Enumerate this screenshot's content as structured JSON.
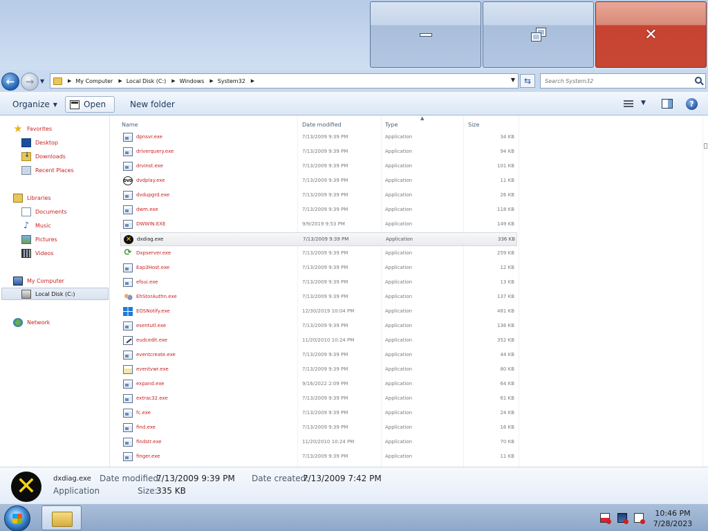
{
  "window": {
    "caption_buttons": [
      "minimize",
      "restore",
      "close"
    ]
  },
  "address": {
    "crumbs": [
      "My Computer",
      "Local Disk (C:)",
      "Windows",
      "System32"
    ],
    "search_placeholder": "Search System32"
  },
  "toolbar": {
    "organize": "Organize",
    "open": "Open",
    "new_folder": "New folder"
  },
  "nav": {
    "favorites": "Favorites",
    "desktop": "Desktop",
    "downloads": "Downloads",
    "recent_places": "Recent Places",
    "libraries": "Libraries",
    "documents": "Documents",
    "music": "Music",
    "pictures": "Pictures",
    "videos": "Videos",
    "my_computer": "My Computer",
    "local_disk": "Local Disk (C:)",
    "network": "Network"
  },
  "columns": {
    "name": "Name",
    "date_modified": "Date modified",
    "type": "Type",
    "size": "Size"
  },
  "files": [
    {
      "name": "dpnsvr.exe",
      "date": "7/13/2009 9:39 PM",
      "type": "Application",
      "size": "34 KB",
      "icon": "app"
    },
    {
      "name": "driverquery.exe",
      "date": "7/13/2009 9:39 PM",
      "type": "Application",
      "size": "94 KB",
      "icon": "app"
    },
    {
      "name": "drvinst.exe",
      "date": "7/13/2009 9:39 PM",
      "type": "Application",
      "size": "101 KB",
      "icon": "app"
    },
    {
      "name": "dvdplay.exe",
      "date": "7/13/2009 9:39 PM",
      "type": "Application",
      "size": "11 KB",
      "icon": "dvd"
    },
    {
      "name": "dvdupgrd.exe",
      "date": "7/13/2009 9:39 PM",
      "type": "Application",
      "size": "26 KB",
      "icon": "app"
    },
    {
      "name": "dwm.exe",
      "date": "7/13/2009 9:39 PM",
      "type": "Application",
      "size": "118 KB",
      "icon": "app"
    },
    {
      "name": "DWWIN.EXE",
      "date": "9/9/2019 9:53 PM",
      "type": "Application",
      "size": "149 KB",
      "icon": "app"
    },
    {
      "name": "dxdiag.exe",
      "date": "7/13/2009 9:39 PM",
      "type": "Application",
      "size": "336 KB",
      "icon": "dx",
      "selected": true
    },
    {
      "name": "Dxpserver.exe",
      "date": "7/13/2009 9:39 PM",
      "type": "Application",
      "size": "259 KB",
      "icon": "sync"
    },
    {
      "name": "Eap3Host.exe",
      "date": "7/13/2009 9:39 PM",
      "type": "Application",
      "size": "12 KB",
      "icon": "app"
    },
    {
      "name": "efsui.exe",
      "date": "7/13/2009 9:39 PM",
      "type": "Application",
      "size": "13 KB",
      "icon": "app"
    },
    {
      "name": "EhStorAuthn.exe",
      "date": "7/13/2009 9:39 PM",
      "type": "Application",
      "size": "137 KB",
      "icon": "users"
    },
    {
      "name": "EOSNotify.exe",
      "date": "12/30/2019 10:04 PM",
      "type": "Application",
      "size": "481 KB",
      "icon": "win"
    },
    {
      "name": "esentutl.exe",
      "date": "7/13/2009 9:39 PM",
      "type": "Application",
      "size": "136 KB",
      "icon": "app"
    },
    {
      "name": "eudcedit.exe",
      "date": "11/20/2010 10:24 PM",
      "type": "Application",
      "size": "352 KB",
      "icon": "edit"
    },
    {
      "name": "eventcreate.exe",
      "date": "7/13/2009 9:39 PM",
      "type": "Application",
      "size": "44 KB",
      "icon": "app"
    },
    {
      "name": "eventvwr.exe",
      "date": "7/13/2009 9:39 PM",
      "type": "Application",
      "size": "80 KB",
      "icon": "evt"
    },
    {
      "name": "expand.exe",
      "date": "9/16/2022 2:09 PM",
      "type": "Application",
      "size": "64 KB",
      "icon": "app"
    },
    {
      "name": "extrac32.exe",
      "date": "7/13/2009 9:39 PM",
      "type": "Application",
      "size": "61 KB",
      "icon": "app"
    },
    {
      "name": "fc.exe",
      "date": "7/13/2009 9:39 PM",
      "type": "Application",
      "size": "24 KB",
      "icon": "app"
    },
    {
      "name": "find.exe",
      "date": "7/13/2009 9:39 PM",
      "type": "Application",
      "size": "16 KB",
      "icon": "app"
    },
    {
      "name": "findstr.exe",
      "date": "11/20/2010 10:24 PM",
      "type": "Application",
      "size": "70 KB",
      "icon": "app"
    },
    {
      "name": "finger.exe",
      "date": "7/13/2009 9:39 PM",
      "type": "Application",
      "size": "11 KB",
      "icon": "app"
    }
  ],
  "details": {
    "filename": "dxdiag.exe",
    "filetype": "Application",
    "date_modified_label": "Date modified:",
    "date_modified": "7/13/2009 9:39 PM",
    "date_created_label": "Date created:",
    "date_created": "7/13/2009 7:42 PM",
    "size_label": "Size:",
    "size": "335 KB"
  },
  "taskbar": {
    "time": "10:46 PM",
    "date": "7/28/2023"
  },
  "colors": {
    "titlebar": "#c6d7ee",
    "close_button": "#c84332",
    "item_text": "#c81f1f"
  }
}
